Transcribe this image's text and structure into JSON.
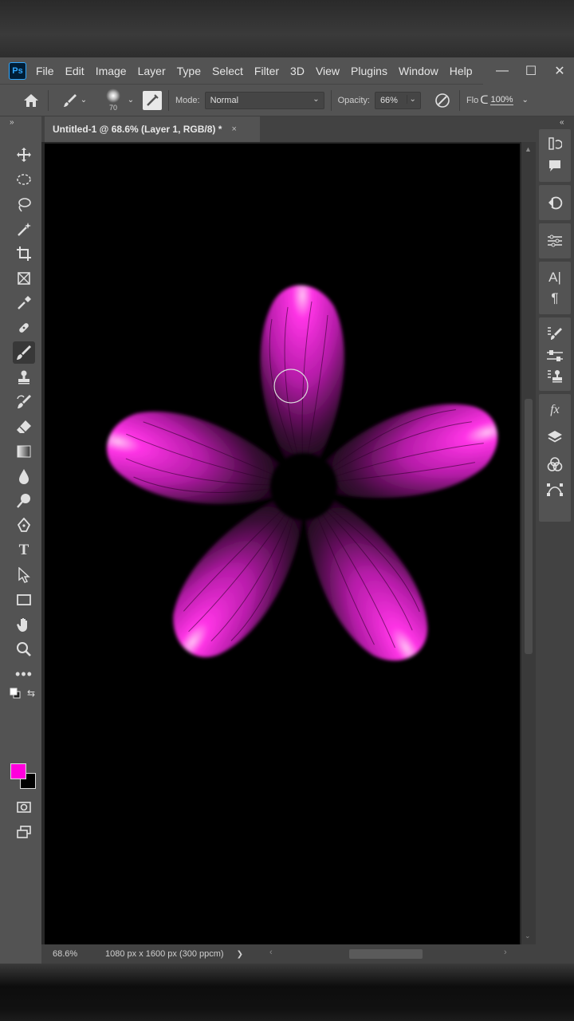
{
  "app": {
    "logo": "Ps"
  },
  "menu": [
    "File",
    "Edit",
    "Image",
    "Layer",
    "Type",
    "Select",
    "Filter",
    "3D",
    "View",
    "Plugins",
    "Window",
    "Help"
  ],
  "window_controls": {
    "minimize": "—",
    "maximize": "☐",
    "close": "✕"
  },
  "options": {
    "brush_size": "70",
    "mode_label": "Mode:",
    "mode_value": "Normal",
    "opacity_label": "Opacity:",
    "opacity_value": "66%",
    "flow_label": "Flo",
    "flow_value": "100%"
  },
  "document": {
    "tab_title": "Untitled-1 @ 68.6% (Layer 1, RGB/8) *",
    "close": "×"
  },
  "status": {
    "zoom": "68.6%",
    "dimensions": "1080 px x 1600 px (300 ppcm)",
    "arrow": "❯"
  },
  "colors": {
    "foreground": "#ff00dc",
    "background": "#000000",
    "petal": "#ff2ee6"
  },
  "tools": [
    "move-tool-icon",
    "marquee-tool-icon",
    "lasso-tool-icon",
    "magic-wand-tool-icon",
    "crop-tool-icon",
    "frame-tool-icon",
    "eyedropper-tool-icon",
    "healing-brush-tool-icon",
    "brush-tool-icon",
    "clone-stamp-tool-icon",
    "history-brush-tool-icon",
    "eraser-tool-icon",
    "gradient-tool-icon",
    "blur-tool-icon",
    "dodge-tool-icon",
    "pen-tool-icon",
    "type-tool-icon",
    "path-selection-tool-icon",
    "rectangle-tool-icon",
    "hand-tool-icon",
    "zoom-tool-icon",
    "more-tools-icon"
  ]
}
